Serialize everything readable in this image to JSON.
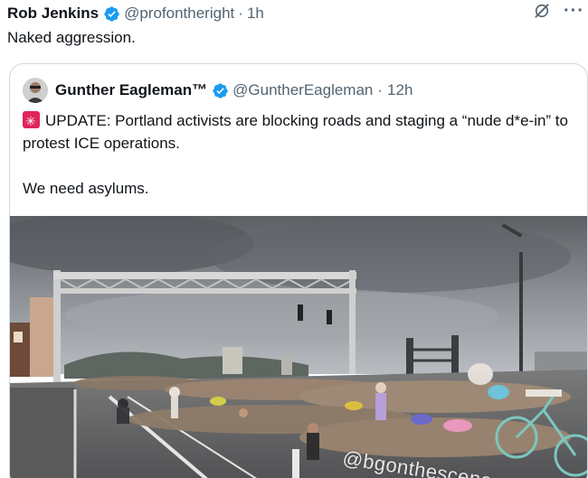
{
  "post": {
    "author_name": "Rob Jenkins",
    "handle": "@profontheright",
    "separator": "·",
    "time": "1h",
    "text": "Naked aggression.",
    "more_label": "···"
  },
  "quote": {
    "author_name": "Gunther Eagleman™",
    "handle": "@GuntherEagleman",
    "separator": "·",
    "time": "12h",
    "text_line1": "UPDATE: Portland activists are blocking roads and staging a “nude d*e-in” to protest ICE operations.",
    "text_line2": "We need asylums.",
    "media_watermark": "@bgonthescene"
  },
  "colors": {
    "text_primary": "#0f1419",
    "text_secondary": "#536471",
    "verified_blue": "#1d9bf0",
    "border": "#cfd9de",
    "update_icon": "#e0245e"
  },
  "icons": {
    "verified": "verified-badge-icon",
    "grok": "grok-icon",
    "more": "more-icon",
    "update": "update-icon"
  }
}
